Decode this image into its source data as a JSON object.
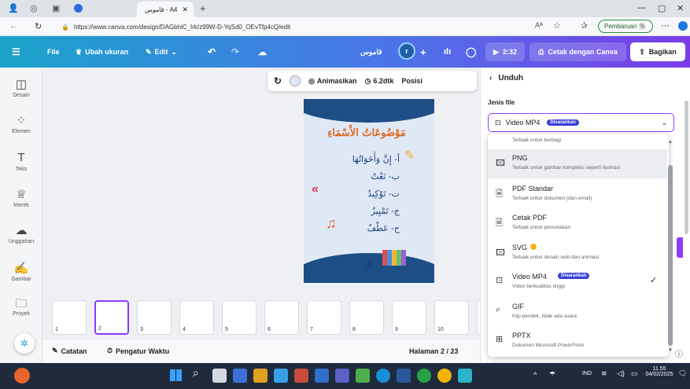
{
  "browser": {
    "tab_title": "قاموس - A4",
    "url": "https://www.canva.com/design/DAGbhiC_Irk/z99W-D-YqSd0_OEvTfp4cQ/edit",
    "update_btn": "Pembaruan"
  },
  "header": {
    "menu": "File",
    "resize": "Ubah ukuran",
    "edit": "Edit",
    "doc_title": "قاموس",
    "avatar": "r",
    "timer": "2:32",
    "print": "Cetak dengan Canva",
    "share": "Bagikan"
  },
  "sidebar": [
    {
      "icon": "layout-icon",
      "label": "Desain"
    },
    {
      "icon": "elements-icon",
      "label": "Elemen"
    },
    {
      "icon": "text-icon",
      "label": "Teks"
    },
    {
      "icon": "brand-icon",
      "label": "Merek"
    },
    {
      "icon": "upload-icon",
      "label": "Unggahan"
    },
    {
      "icon": "draw-icon",
      "label": "Gambar"
    },
    {
      "icon": "projects-icon",
      "label": "Proyek"
    }
  ],
  "toolbar": {
    "animate": "Animasikan",
    "duration": "6.2dtk",
    "position": "Posisi"
  },
  "slide": {
    "title": "مَوْضُوعَاتُ الأَسْمَاءِ",
    "items": [
      "أ- إِنَّ وَأَخَوَاتُهَا",
      "ب- نَعْتٌ",
      "ت- تَوْكِيدٌ",
      "ج- تَمْيِيزٌ",
      "ح- عَطْفٌ"
    ],
    "number": "①"
  },
  "thumbnails": [
    "1",
    "2",
    "3",
    "4",
    "5",
    "6",
    "7",
    "8",
    "9",
    "10",
    "11"
  ],
  "bottom": {
    "notes": "Catatan",
    "timer": "Pengatur Waktu",
    "page": "Halaman 2 / 23"
  },
  "panel": {
    "back": "Unduh",
    "file_type_label": "Jenis file",
    "selected": "Video MP4",
    "recommended": "Disarankan",
    "partial_sub": "Terbaik untuk berbagi",
    "options": [
      {
        "icon": "image-icon",
        "title": "PNG",
        "sub": "Terbaik untuk gambar kompleks seperti ilustrasi"
      },
      {
        "icon": "document-icon",
        "title": "PDF Standar",
        "sub": "Terbaik untuk dokumen (dan email)"
      },
      {
        "icon": "document-icon",
        "title": "Cetak PDF",
        "sub": "Terbaik untuk pencetakan"
      },
      {
        "icon": "image-icon",
        "title": "SVG",
        "sub": "Terbaik untuk desain web dan animasi"
      },
      {
        "icon": "video-icon",
        "title": "Video MP4",
        "sub": "Video berkualitas tinggi"
      },
      {
        "icon": "gif-icon",
        "title": "GIF",
        "sub": "Klip pendek, tidak ada suara"
      },
      {
        "icon": "slides-icon",
        "title": "PPTX",
        "sub": "Dokumen Microsoft PowerPoint"
      }
    ]
  },
  "taskbar": {
    "lang": "IND",
    "time": "11.55",
    "date": "04/02/2025"
  }
}
